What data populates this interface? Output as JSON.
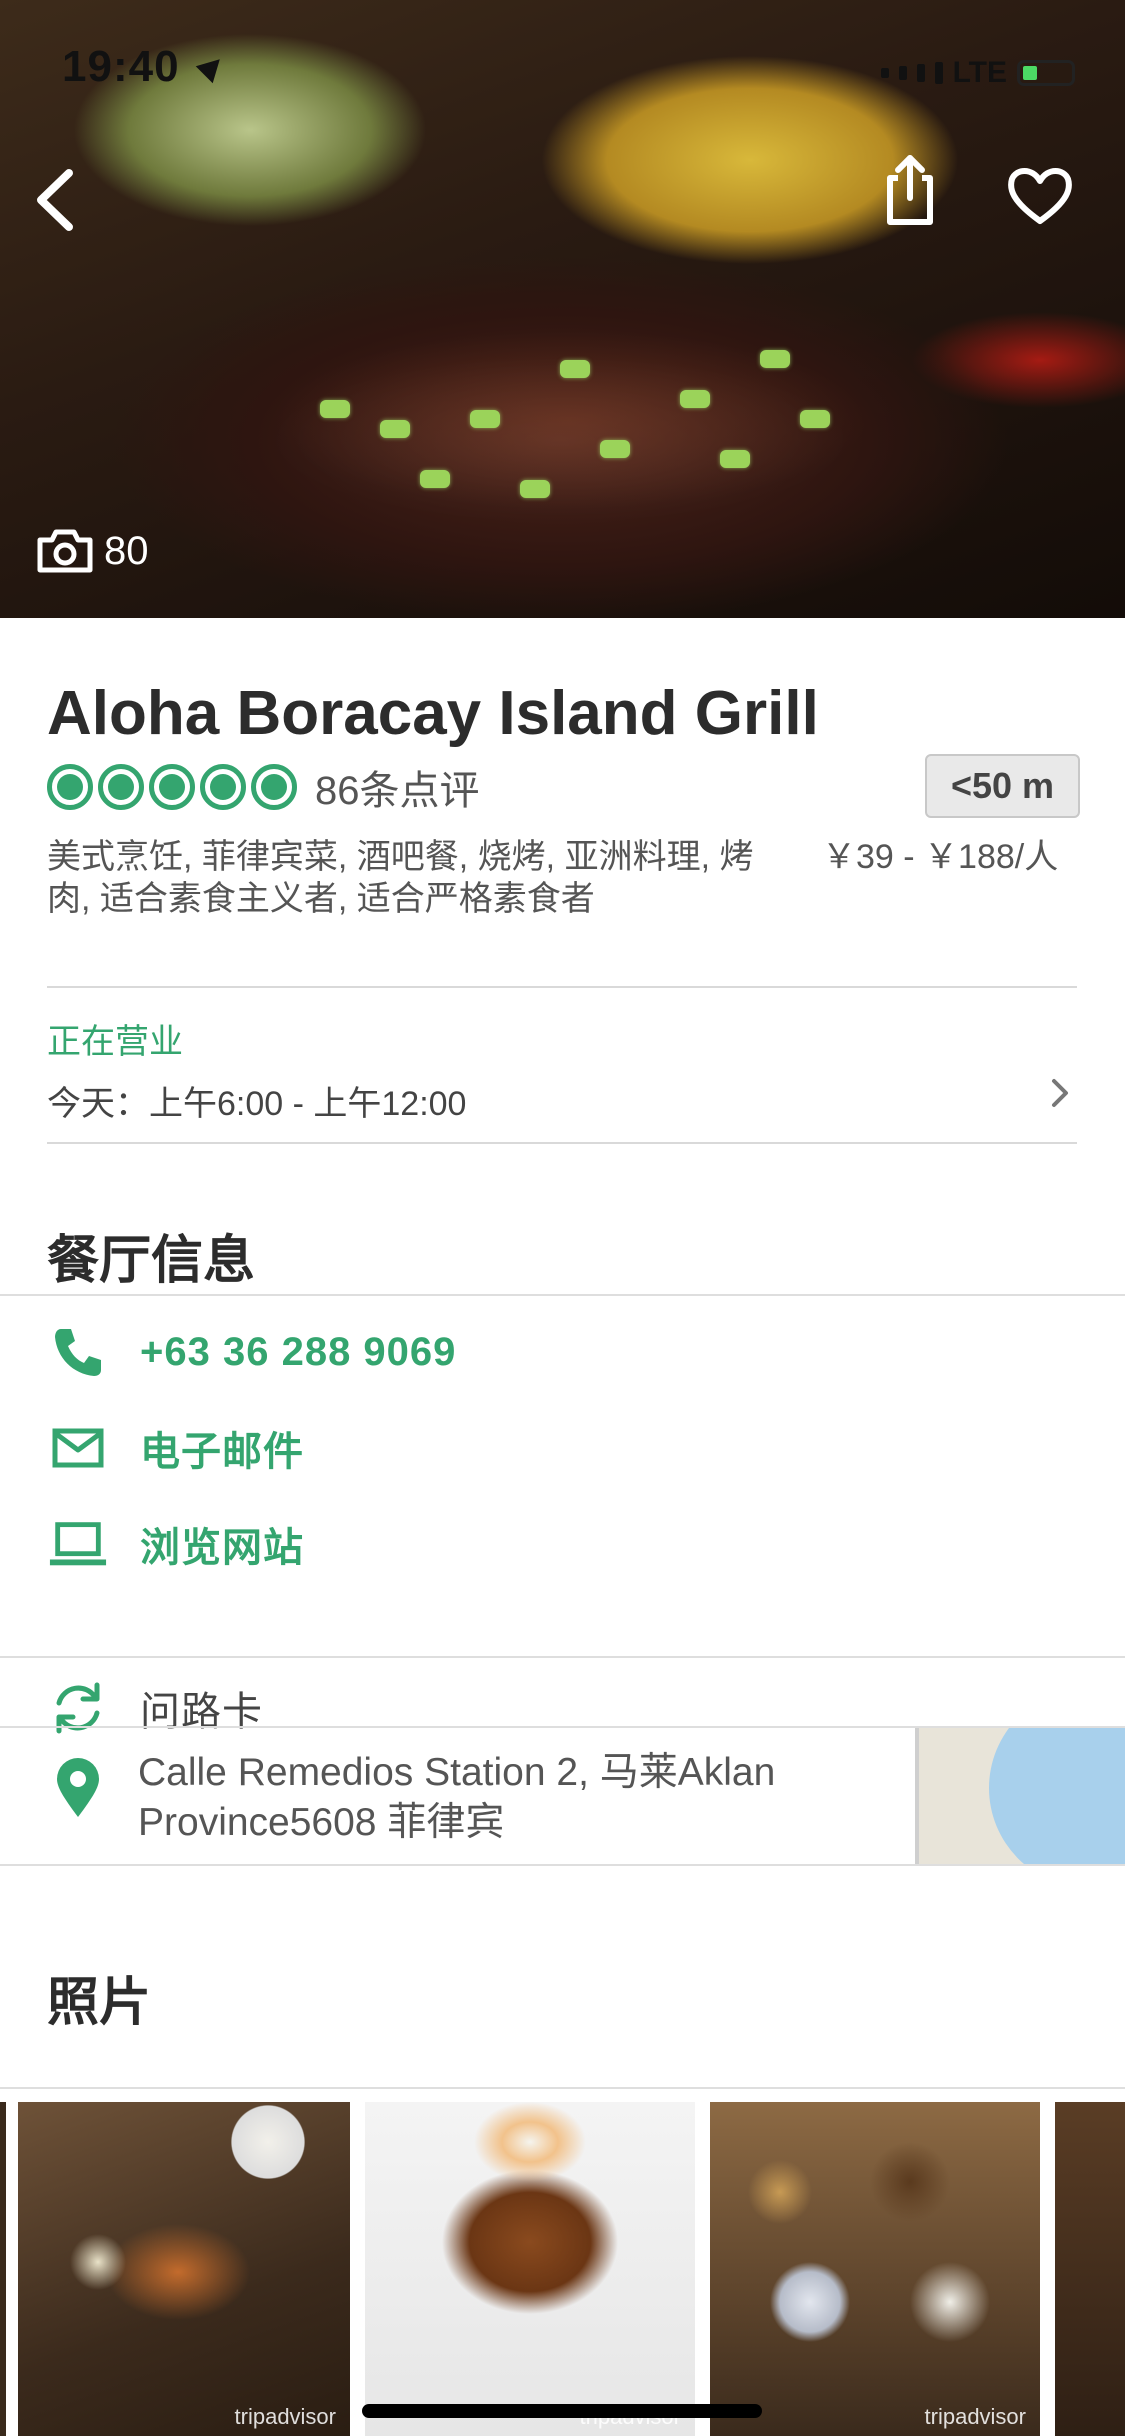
{
  "status_bar": {
    "time": "19:40",
    "network": "LTE"
  },
  "hero": {
    "photo_count": "80"
  },
  "restaurant": {
    "name": "Aloha Boracay Island Grill",
    "rating_bubbles": 5,
    "reviews": "86条点评",
    "distance": "<50 m",
    "cuisine_line1": "美式烹饪, 菲律宾菜, 酒吧餐, 烧烤, 亚洲料理, 烤",
    "cuisine_line2": "肉, 适合素食主义者, 适合严格素食者",
    "price": "￥39 - ￥188/人"
  },
  "hours": {
    "status": "正在营业",
    "today": "今天：上午6:00 - 上午12:00"
  },
  "info_section": {
    "title": "餐厅信息",
    "phone": "+63 36 288 9069",
    "email": "电子邮件",
    "website": "浏览网站",
    "directions_card": "问路卡",
    "address_line1": "Calle Remedios Station 2, 马莱Aklan",
    "address_line2": "Province5608 菲律宾"
  },
  "photos_section": {
    "title": "照片",
    "watermark": "tripadvisor"
  },
  "colors": {
    "accent": "#34a56f",
    "text": "#2c2c2c",
    "muted": "#555555"
  }
}
